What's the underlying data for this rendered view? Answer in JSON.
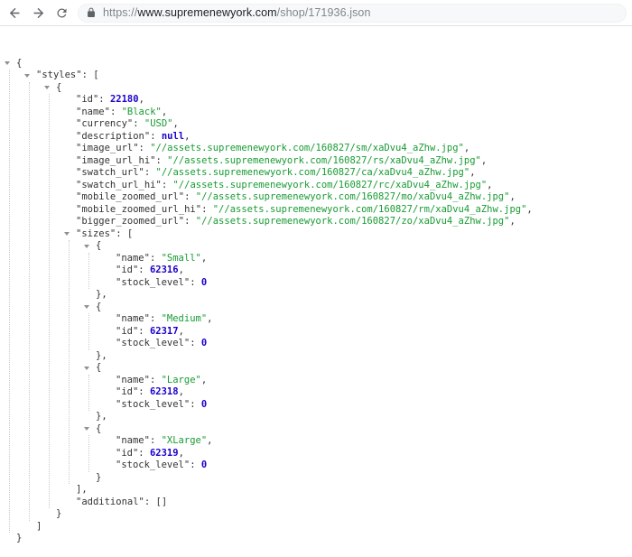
{
  "browser": {
    "back_icon": "back-arrow-icon",
    "forward_icon": "forward-arrow-icon",
    "reload_icon": "reload-icon",
    "lock_icon": "lock-icon",
    "url": {
      "scheme": "https://",
      "host": "www.supremenewyork.com",
      "path": "/shop/171936.json"
    }
  },
  "colors": {
    "json_key": "#333333",
    "json_punct": "#333333",
    "json_string": "#189b33",
    "json_number": "#1a01cc",
    "guide": "#c9c9c9",
    "triangle": "#909090",
    "toolbar_icon": "#5f6368",
    "url_dim": "#80868b",
    "url_host": "#202124",
    "toolbar_border": "#dfe1e5",
    "pill_bg": "#f7f8f9"
  },
  "json_document": {
    "styles": [
      {
        "id": 22180,
        "name": "Black",
        "currency": "USD",
        "description": null,
        "image_url": "//assets.supremenewyork.com/160827/sm/xaDvu4_aZhw.jpg",
        "image_url_hi": "//assets.supremenewyork.com/160827/rs/xaDvu4_aZhw.jpg",
        "swatch_url": "//assets.supremenewyork.com/160827/ca/xaDvu4_aZhw.jpg",
        "swatch_url_hi": "//assets.supremenewyork.com/160827/rc/xaDvu4_aZhw.jpg",
        "mobile_zoomed_url": "//assets.supremenewyork.com/160827/mo/xaDvu4_aZhw.jpg",
        "mobile_zoomed_url_hi": "//assets.supremenewyork.com/160827/rm/xaDvu4_aZhw.jpg",
        "bigger_zoomed_url": "//assets.supremenewyork.com/160827/zo/xaDvu4_aZhw.jpg",
        "sizes": [
          {
            "name": "Small",
            "id": 62316,
            "stock_level": 0
          },
          {
            "name": "Medium",
            "id": 62317,
            "stock_level": 0
          },
          {
            "name": "Large",
            "id": 62318,
            "stock_level": 0
          },
          {
            "name": "XLarge",
            "id": 62319,
            "stock_level": 0
          }
        ],
        "additional": []
      }
    ]
  }
}
